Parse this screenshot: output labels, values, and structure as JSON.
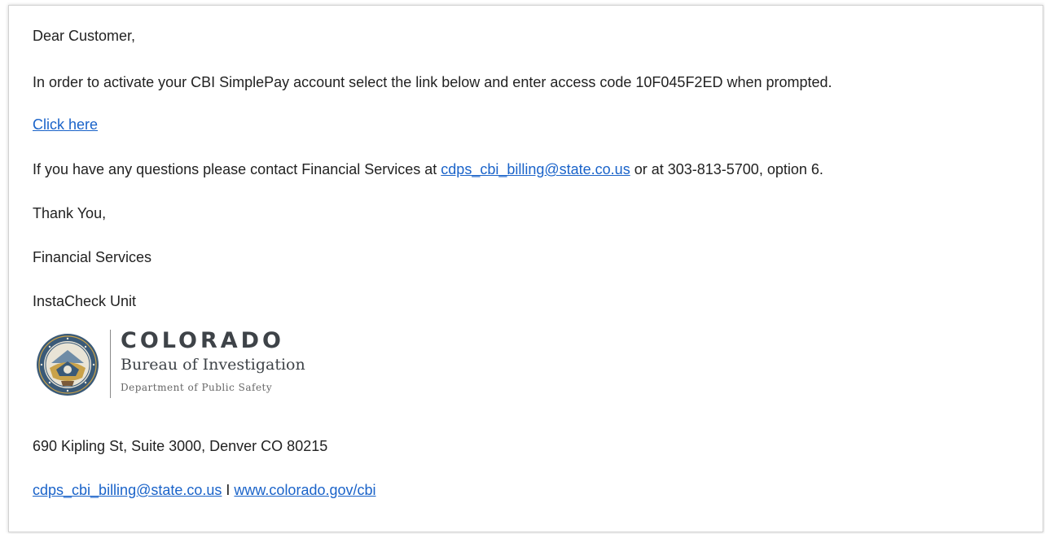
{
  "email": {
    "greeting": "Dear Customer,",
    "body_line": "In order to activate your CBI SimplePay account select the link below and enter access code 10F045F2ED when prompted.",
    "activation_link": "Click here",
    "questions": {
      "before": "If you have any questions please contact Financial Services at ",
      "email_link": "cdps_cbi_billing@state.co.us",
      "after": " or at 303-813-5700, option 6."
    },
    "closing": "Thank You,",
    "signature_dept": "Financial Services",
    "signature_unit": "InstaCheck Unit"
  },
  "logo": {
    "title": "COLORADO",
    "subtitle": "Bureau of Investigation",
    "department": "Department of Public Safety",
    "seal_icon": "cbi-seal-icon",
    "colors": {
      "seal_ring": "#3a5a78",
      "seal_gold": "#c9a24a",
      "text": "#3e4348"
    }
  },
  "footer": {
    "address": "690 Kipling St, Suite 3000, Denver CO 80215",
    "email_link": "cdps_cbi_billing@state.co.us",
    "separator": " I ",
    "website_link": "www.colorado.gov/cbi"
  },
  "colors": {
    "link": "#1a63c9",
    "text": "#222222",
    "border": "#d2d2d2"
  }
}
